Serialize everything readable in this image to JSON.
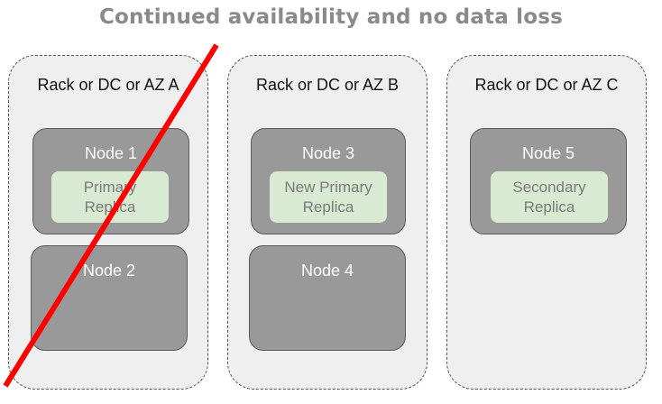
{
  "title": "Continued availability and no data loss",
  "zones": [
    {
      "label": "Rack or DC or AZ A",
      "failed": true,
      "nodes": [
        {
          "label": "Node 1",
          "replica": {
            "line1": "Primary",
            "line2": "Replica"
          }
        },
        {
          "label": "Node 2"
        }
      ]
    },
    {
      "label": "Rack or DC or AZ B",
      "nodes": [
        {
          "label": "Node 3",
          "replica": {
            "line1": "New Primary",
            "line2": "Replica"
          }
        },
        {
          "label": "Node 4"
        }
      ]
    },
    {
      "label": "Rack or DC or AZ C",
      "nodes": [
        {
          "label": "Node 5",
          "replica": {
            "line1": "Secondary",
            "line2": "Replica"
          }
        }
      ]
    }
  ],
  "colors": {
    "zone_bg": "#efefef",
    "node_bg": "#999999",
    "replica_bg": "#d9ead3",
    "failure_mark": "#ff0000"
  }
}
